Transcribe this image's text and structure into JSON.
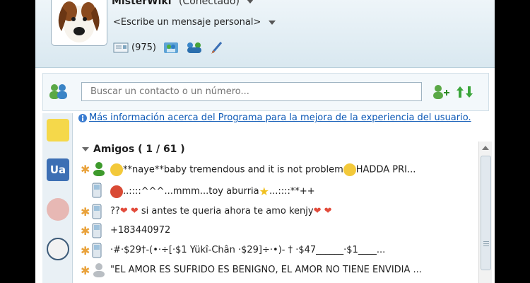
{
  "header": {
    "display_name": "MisterWiki",
    "status": "(Conectado)",
    "personal_message": "<Escribe un mensaje personal>",
    "mail_count": "(975)"
  },
  "search": {
    "placeholder": "Buscar un contacto o un número..."
  },
  "info_bar": {
    "text": "Más información acerca del Programa para la mejora de la experiencia del usuario."
  },
  "contacts": {
    "group_label": "Amigos ( 1 / 61 )",
    "rows": [
      {
        "text": "**naye**baby tremendous and it is not problem",
        "tail": "HADDA PRI...",
        "icon": "person-online-icon",
        "star": true
      },
      {
        "text": "..::::^^^...mmm...toy aburria",
        "tail": "...::::**++",
        "icon": "mobile-phone-icon",
        "star": false
      },
      {
        "text": "??",
        "tail": "si antes te queria ahora te amo kenjy",
        "icon": "mobile-phone-icon",
        "star": true
      },
      {
        "text": "+183440972",
        "tail": "",
        "icon": "mobile-phone-icon",
        "star": true
      },
      {
        "text": "·#·$29†-(•·÷[·$1   Yükî-Chân   ·$29]÷·•)- †   ·$47______·$1____...",
        "tail": "",
        "icon": "mobile-phone-icon",
        "star": true
      },
      {
        "text": "\"EL AMOR ES SUFRIDO ES BENIGNO, EL AMOR NO TIENE ENVIDIA ...",
        "tail": "",
        "icon": "person-offline-icon",
        "star": true
      }
    ]
  },
  "colors": {
    "accent": "#0b58b6",
    "star": "#e9a23b",
    "online_green": "#3d9a2c"
  }
}
